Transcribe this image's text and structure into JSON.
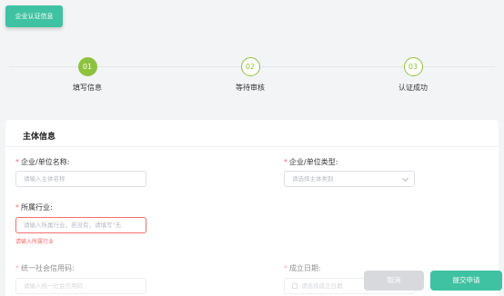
{
  "header": {
    "tab_label": "企业认证信息"
  },
  "steps": [
    {
      "number": "01",
      "label": "填写信息",
      "active": true
    },
    {
      "number": "02",
      "label": "等待审核",
      "active": false
    },
    {
      "number": "03",
      "label": "认证成功",
      "active": false
    }
  ],
  "form": {
    "section_title": "主体信息",
    "required_mark": "*",
    "name_label": "企业/单位名称:",
    "name_placeholder": "请输入主体名称",
    "type_label": "企业/单位类型:",
    "type_placeholder": "请选择主体类别",
    "industry_label": "所属行业:",
    "industry_placeholder": "请输入所属行业，若没有，请填写\"无",
    "industry_error": "请输入所属行业",
    "credit_code_label": "统一社会信用码:",
    "credit_code_placeholder": "请输入统一社会信用码",
    "date_label": "成立日期:",
    "date_placeholder": "请选择成立日期"
  },
  "actions": {
    "cancel_label": "取消",
    "submit_label": "提交申请"
  },
  "colors": {
    "accent": "#3fc2a2",
    "step_green": "#8dc23f",
    "error": "#f56c6c"
  }
}
